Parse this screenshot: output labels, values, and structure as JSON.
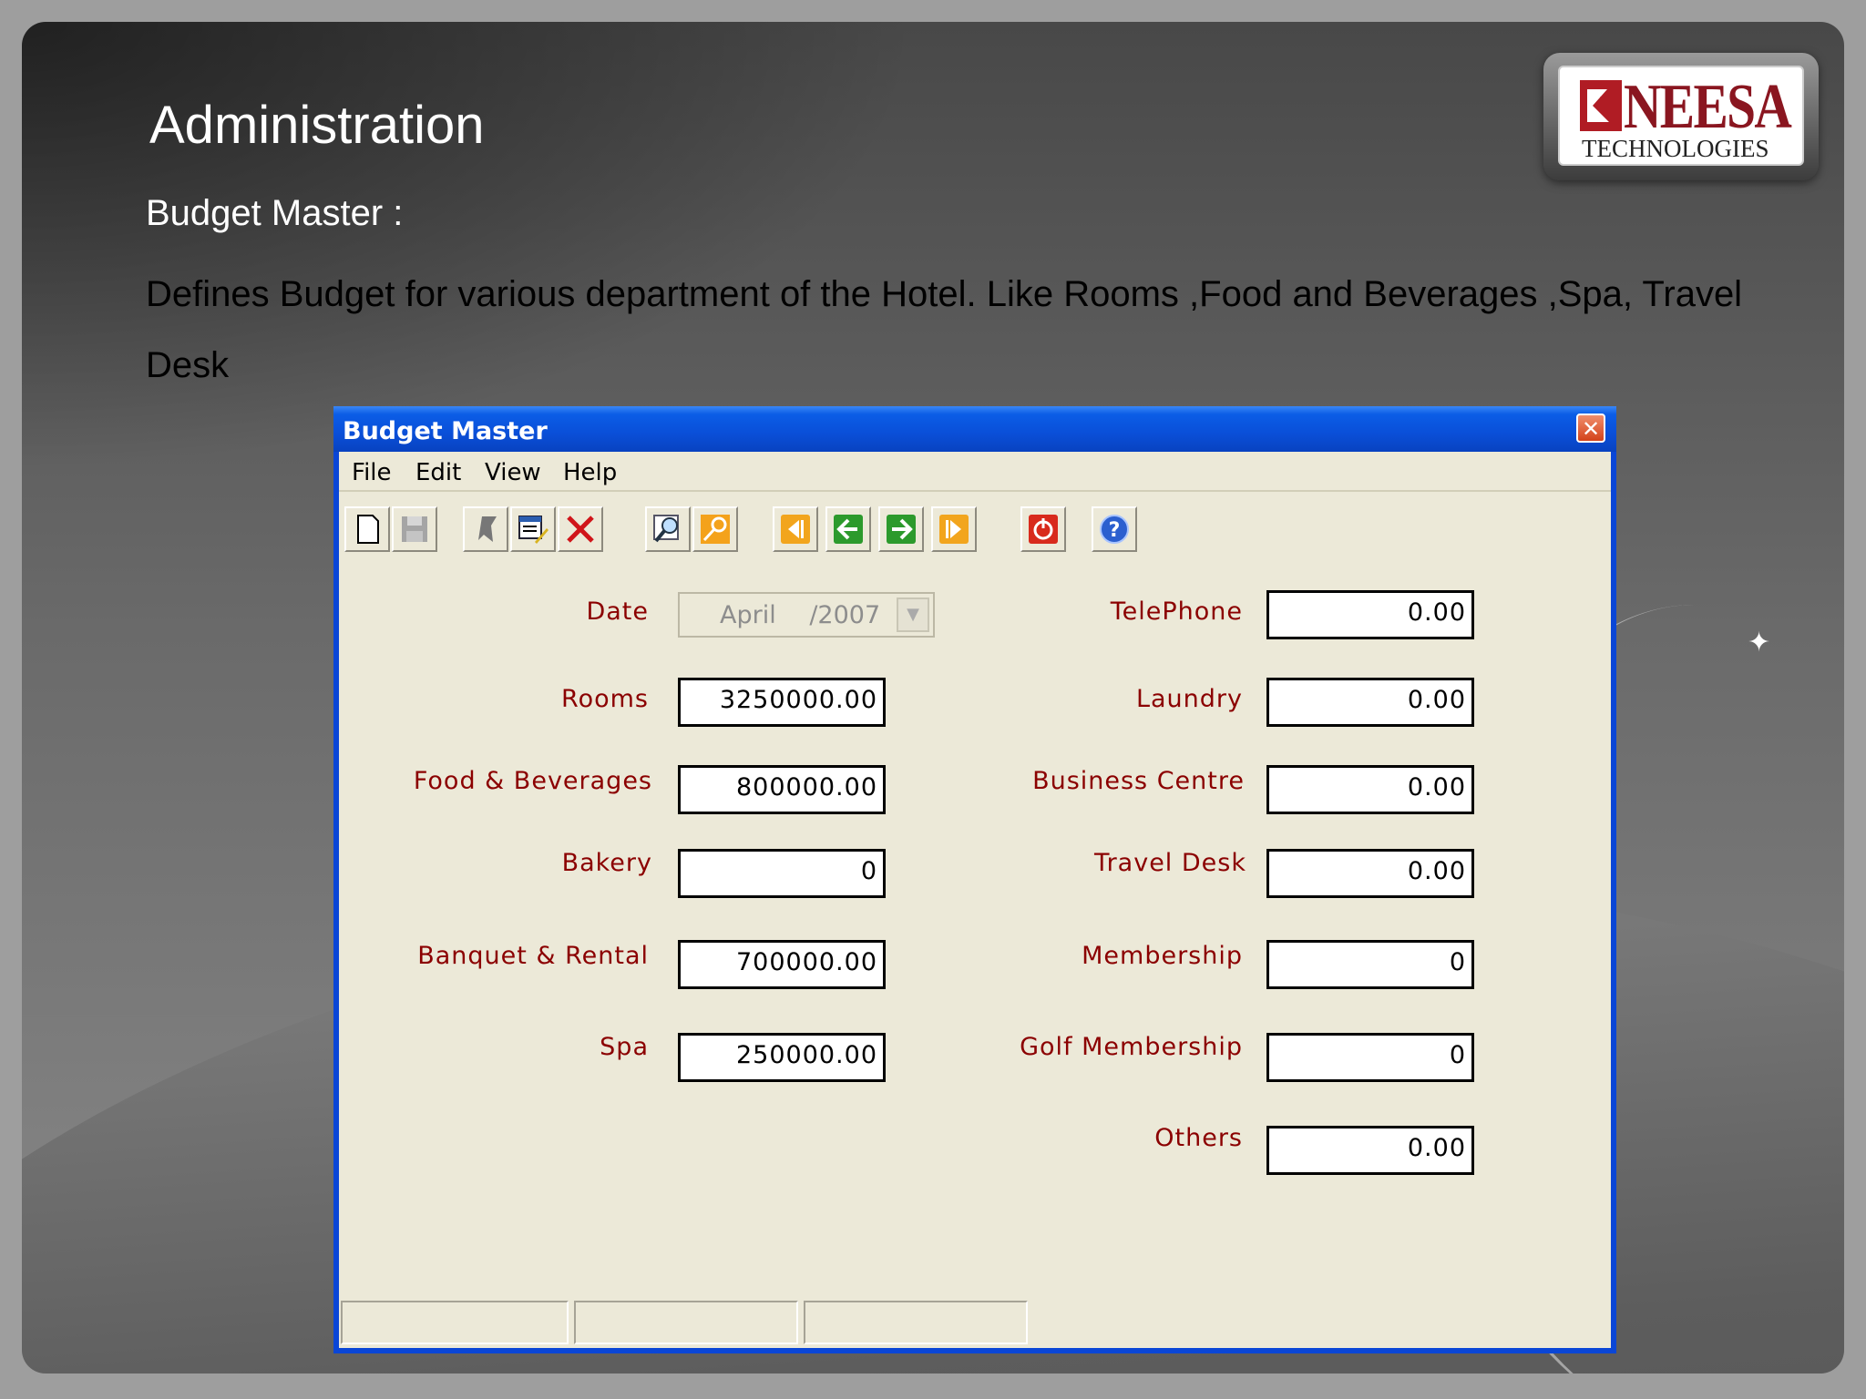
{
  "slide": {
    "heading": "Administration",
    "subheading": "Budget Master :",
    "description": "Defines Budget for various department of the Hotel. Like Rooms ,Food and Beverages ,Spa, Travel Desk",
    "logo": {
      "name": "NEESA",
      "tagline": "TECHNOLOGIES"
    }
  },
  "window": {
    "title": "Budget Master",
    "close_label": "✕",
    "menu": [
      "File",
      "Edit",
      "View",
      "Help"
    ],
    "toolbar_icons": [
      "new-icon",
      "save-icon",
      "undo-icon",
      "edit-icon",
      "delete-icon",
      "find-icon",
      "key-icon",
      "first-record-icon",
      "previous-record-icon",
      "next-record-icon",
      "last-record-icon",
      "exit-icon",
      "help-icon"
    ],
    "date": {
      "label": "Date",
      "month": "April",
      "year": "/2007"
    },
    "left_fields": [
      {
        "label": "Rooms",
        "value": "3250000.00"
      },
      {
        "label": "Food & Beverages",
        "value": "800000.00"
      },
      {
        "label": "Bakery",
        "value": "0"
      },
      {
        "label": "Banquet & Rental",
        "value": "700000.00"
      },
      {
        "label": "Spa",
        "value": "250000.00"
      }
    ],
    "right_fields": [
      {
        "label": "TelePhone",
        "value": "0.00"
      },
      {
        "label": "Laundry",
        "value": "0.00"
      },
      {
        "label": "Business Centre",
        "value": "0.00"
      },
      {
        "label": "Travel Desk",
        "value": "0.00"
      },
      {
        "label": "Membership",
        "value": "0"
      },
      {
        "label": "Golf Membership",
        "value": "0"
      },
      {
        "label": "Others",
        "value": "0.00"
      }
    ],
    "colors": {
      "title_bar": "#0a4fd8",
      "label": "#8b0000",
      "window_bg": "#ece9d8"
    }
  }
}
